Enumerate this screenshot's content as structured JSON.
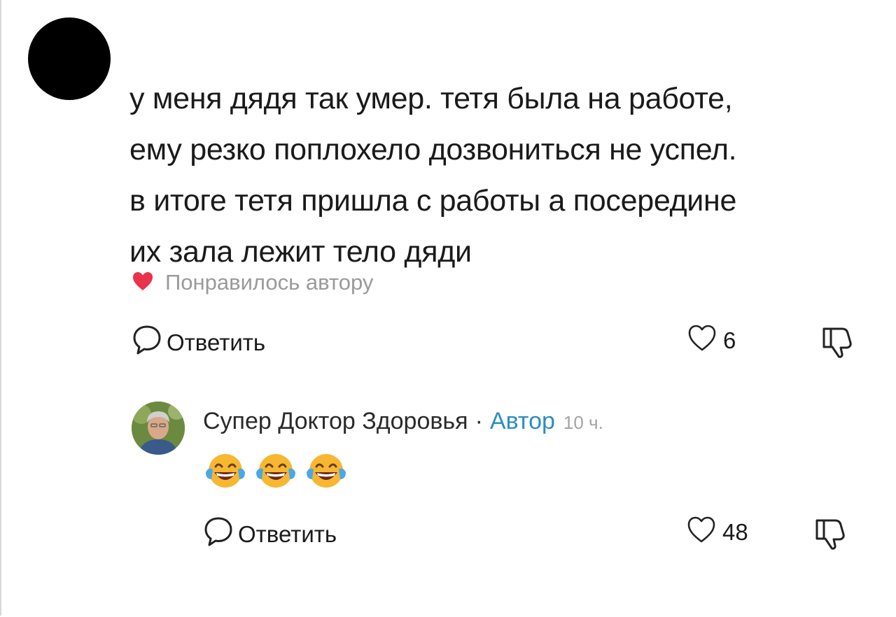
{
  "comment": {
    "lines": [
      "у меня дядя так умер. тетя была на работе,",
      "ему резко поплохело дозвониться не успел.",
      "в итоге тетя пришла с работы а посередине",
      "их зала лежит тело дяди"
    ],
    "liked_by_author_label": "Понравилось автору",
    "reply_label": "Ответить",
    "like_count": "6"
  },
  "reply": {
    "author_name": "Супер Доктор Здоровья",
    "separator": "·",
    "author_badge": "Автор",
    "time": "10 ч.",
    "emojis": [
      "face-with-tears-of-joy",
      "face-with-tears-of-joy",
      "face-with-tears-of-joy"
    ],
    "reply_label": "Ответить",
    "like_count": "48"
  },
  "colors": {
    "heart": "#e8334a",
    "badge": "#2a8ec2",
    "muted": "#9a9a9a"
  }
}
